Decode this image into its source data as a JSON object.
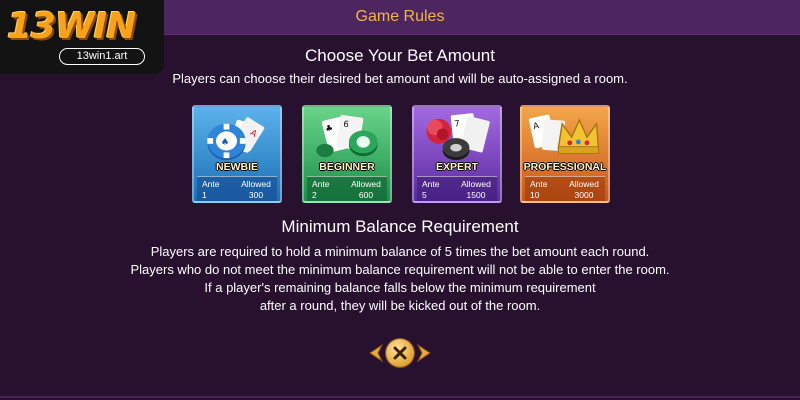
{
  "header": {
    "title": "Game Rules"
  },
  "logo": {
    "brand": "13WIN",
    "url": "13win1.art"
  },
  "bet_section": {
    "title": "Choose Your Bet Amount",
    "description": "Players can choose their desired bet amount and will be auto-assigned a room."
  },
  "rooms": [
    {
      "name": "NEWBIE",
      "ante_label": "Ante",
      "allowed_label": "Allowed",
      "ante": "1",
      "allowed": "300",
      "icon": "poker-chips-cards-icon",
      "color": "#2f8ad6"
    },
    {
      "name": "BEGINNER",
      "ante_label": "Ante",
      "allowed_label": "Allowed",
      "ante": "2",
      "allowed": "600",
      "icon": "cards-chips-icon",
      "color": "#33b063"
    },
    {
      "name": "EXPERT",
      "ante_label": "Ante",
      "allowed_label": "Allowed",
      "ante": "5",
      "allowed": "1500",
      "icon": "cards-rose-chips-icon",
      "color": "#7b44c4"
    },
    {
      "name": "PROFESSIONAL",
      "ante_label": "Ante",
      "allowed_label": "Allowed",
      "ante": "10",
      "allowed": "3000",
      "icon": "crown-cards-icon",
      "color": "#e27c2c"
    }
  ],
  "balance_section": {
    "title": "Minimum Balance Requirement",
    "lines": [
      "Players are required to hold a minimum balance of 5 times the bet amount each round.",
      "Players who do not meet the minimum balance requirement will not be able to enter the room.",
      "If a player's remaining balance falls below the minimum requirement",
      "after a round, they will be kicked out of the room."
    ]
  },
  "close_button": {
    "icon": "close-icon"
  },
  "colors": {
    "background": "#28102f",
    "header": "#4d2660",
    "accent": "#f3b449"
  }
}
